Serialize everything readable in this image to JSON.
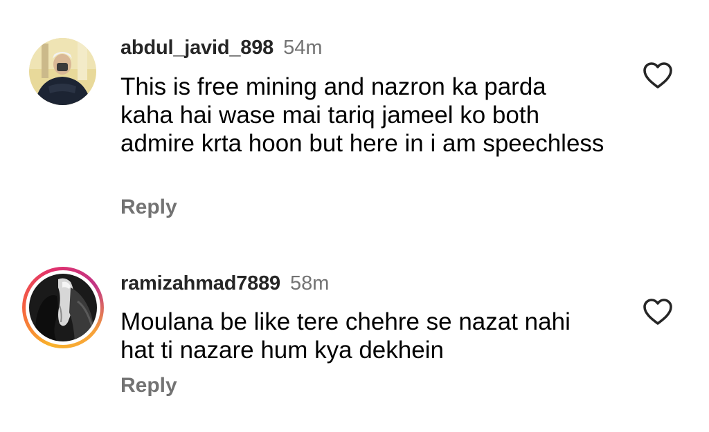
{
  "comments": [
    {
      "username": "abdul_javid_898",
      "time": "54m",
      "text": "This is free mining and nazron ka parda kaha hai wase mai tariq jameel ko both admire krta hoon but here in i am speechless",
      "reply_label": "Reply",
      "avatar_icon": "avatar-photo-person",
      "like_icon": "heart-outline-icon"
    },
    {
      "username": "ramizahmad7889",
      "time": "58m",
      "text": "Moulana be like tere chehre se nazat nahi hat ti nazare hum kya dekhein",
      "reply_label": "Reply",
      "avatar_icon": "avatar-photo-horse",
      "story_ring": true,
      "like_icon": "heart-outline-icon"
    }
  ],
  "colors": {
    "username": "#262626",
    "time": "#737373",
    "reply": "#737373",
    "text": "#000000",
    "story_ring_start": "#f9b22a",
    "story_ring_end": "#c13584"
  }
}
